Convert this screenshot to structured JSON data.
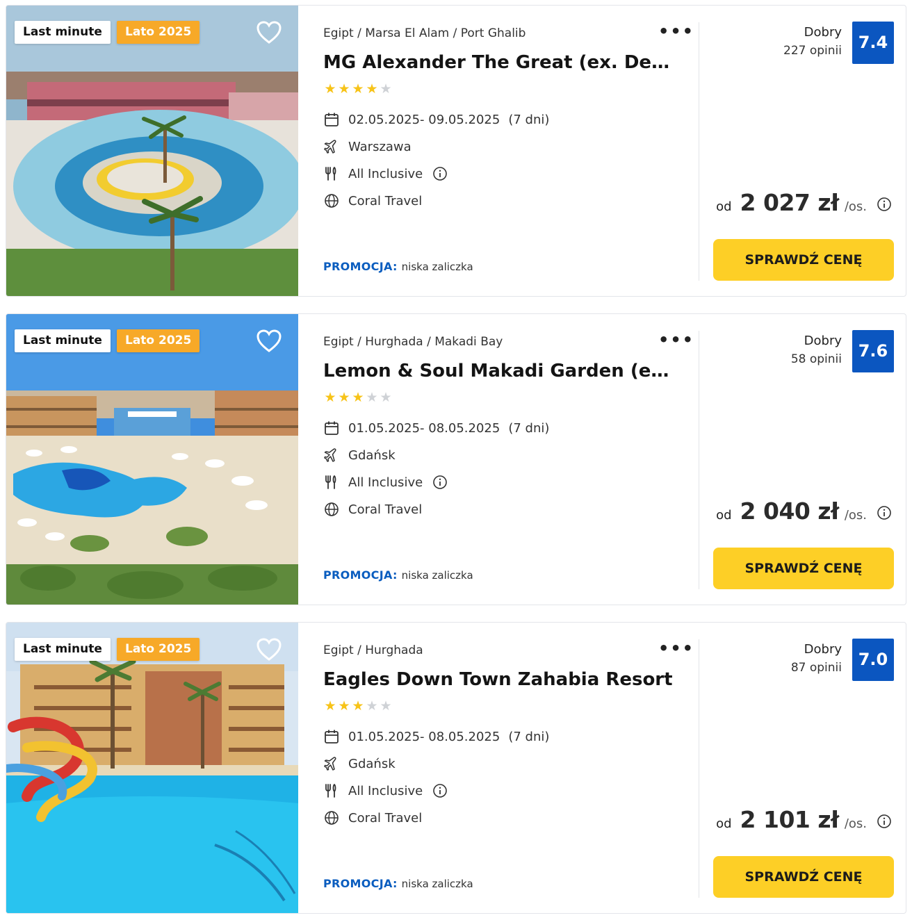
{
  "colors": {
    "brand_blue": "#0b56c0",
    "promo_blue": "#0a5dbf",
    "cta_yellow": "#fdcf26",
    "season_orange": "#f7a928",
    "star_yellow": "#f7c318",
    "star_grey": "#cfd2d6"
  },
  "icons": {
    "heart": "heart-icon",
    "more": "more-dots-icon",
    "calendar": "calendar-icon",
    "departure": "plane-icon",
    "board": "fork-knife-icon",
    "operator": "globe-icon",
    "info": "info-icon"
  },
  "offers": [
    {
      "badge_last_minute": "Last minute",
      "badge_season": "Lato 2025",
      "location": "Egipt / Marsa El Alam / Port Ghalib",
      "title": "MG Alexander The Great (ex. Dessole Port Ghalib)",
      "stars": 4,
      "dates": "02.05.2025- 09.05.2025",
      "nights": "(7 dni)",
      "departure": "Warszawa",
      "board": "All Inclusive",
      "operator": "Coral Travel",
      "promo_label": "PROMOCJA:",
      "promo_value": "niska zaliczka",
      "rating_label": "Dobry",
      "rating_count": "227 opinii",
      "score": "7.4",
      "price_prefix": "od",
      "price": "2 027 zł",
      "price_suffix": "/os.",
      "cta": "SPRAWDŹ CENĘ"
    },
    {
      "badge_last_minute": "Last minute",
      "badge_season": "Lato 2025",
      "location": "Egipt / Hurghada / Makadi Bay",
      "title": "Lemon & Soul Makadi Garden (ex Makadi Garden Azur)",
      "stars": 3,
      "dates": "01.05.2025- 08.05.2025",
      "nights": "(7 dni)",
      "departure": "Gdańsk",
      "board": "All Inclusive",
      "operator": "Coral Travel",
      "promo_label": "PROMOCJA:",
      "promo_value": "niska zaliczka",
      "rating_label": "Dobry",
      "rating_count": "58 opinii",
      "score": "7.6",
      "price_prefix": "od",
      "price": "2 040 zł",
      "price_suffix": "/os.",
      "cta": "SPRAWDŹ CENĘ"
    },
    {
      "badge_last_minute": "Last minute",
      "badge_season": "Lato 2025",
      "location": "Egipt / Hurghada",
      "title": "Eagles Down Town Zahabia Resort",
      "stars": 3,
      "dates": "01.05.2025- 08.05.2025",
      "nights": "(7 dni)",
      "departure": "Gdańsk",
      "board": "All Inclusive",
      "operator": "Coral Travel",
      "promo_label": "PROMOCJA:",
      "promo_value": "niska zaliczka",
      "rating_label": "Dobry",
      "rating_count": "87 opinii",
      "score": "7.0",
      "price_prefix": "od",
      "price": "2 101 zł",
      "price_suffix": "/os.",
      "cta": "SPRAWDŹ CENĘ"
    }
  ]
}
